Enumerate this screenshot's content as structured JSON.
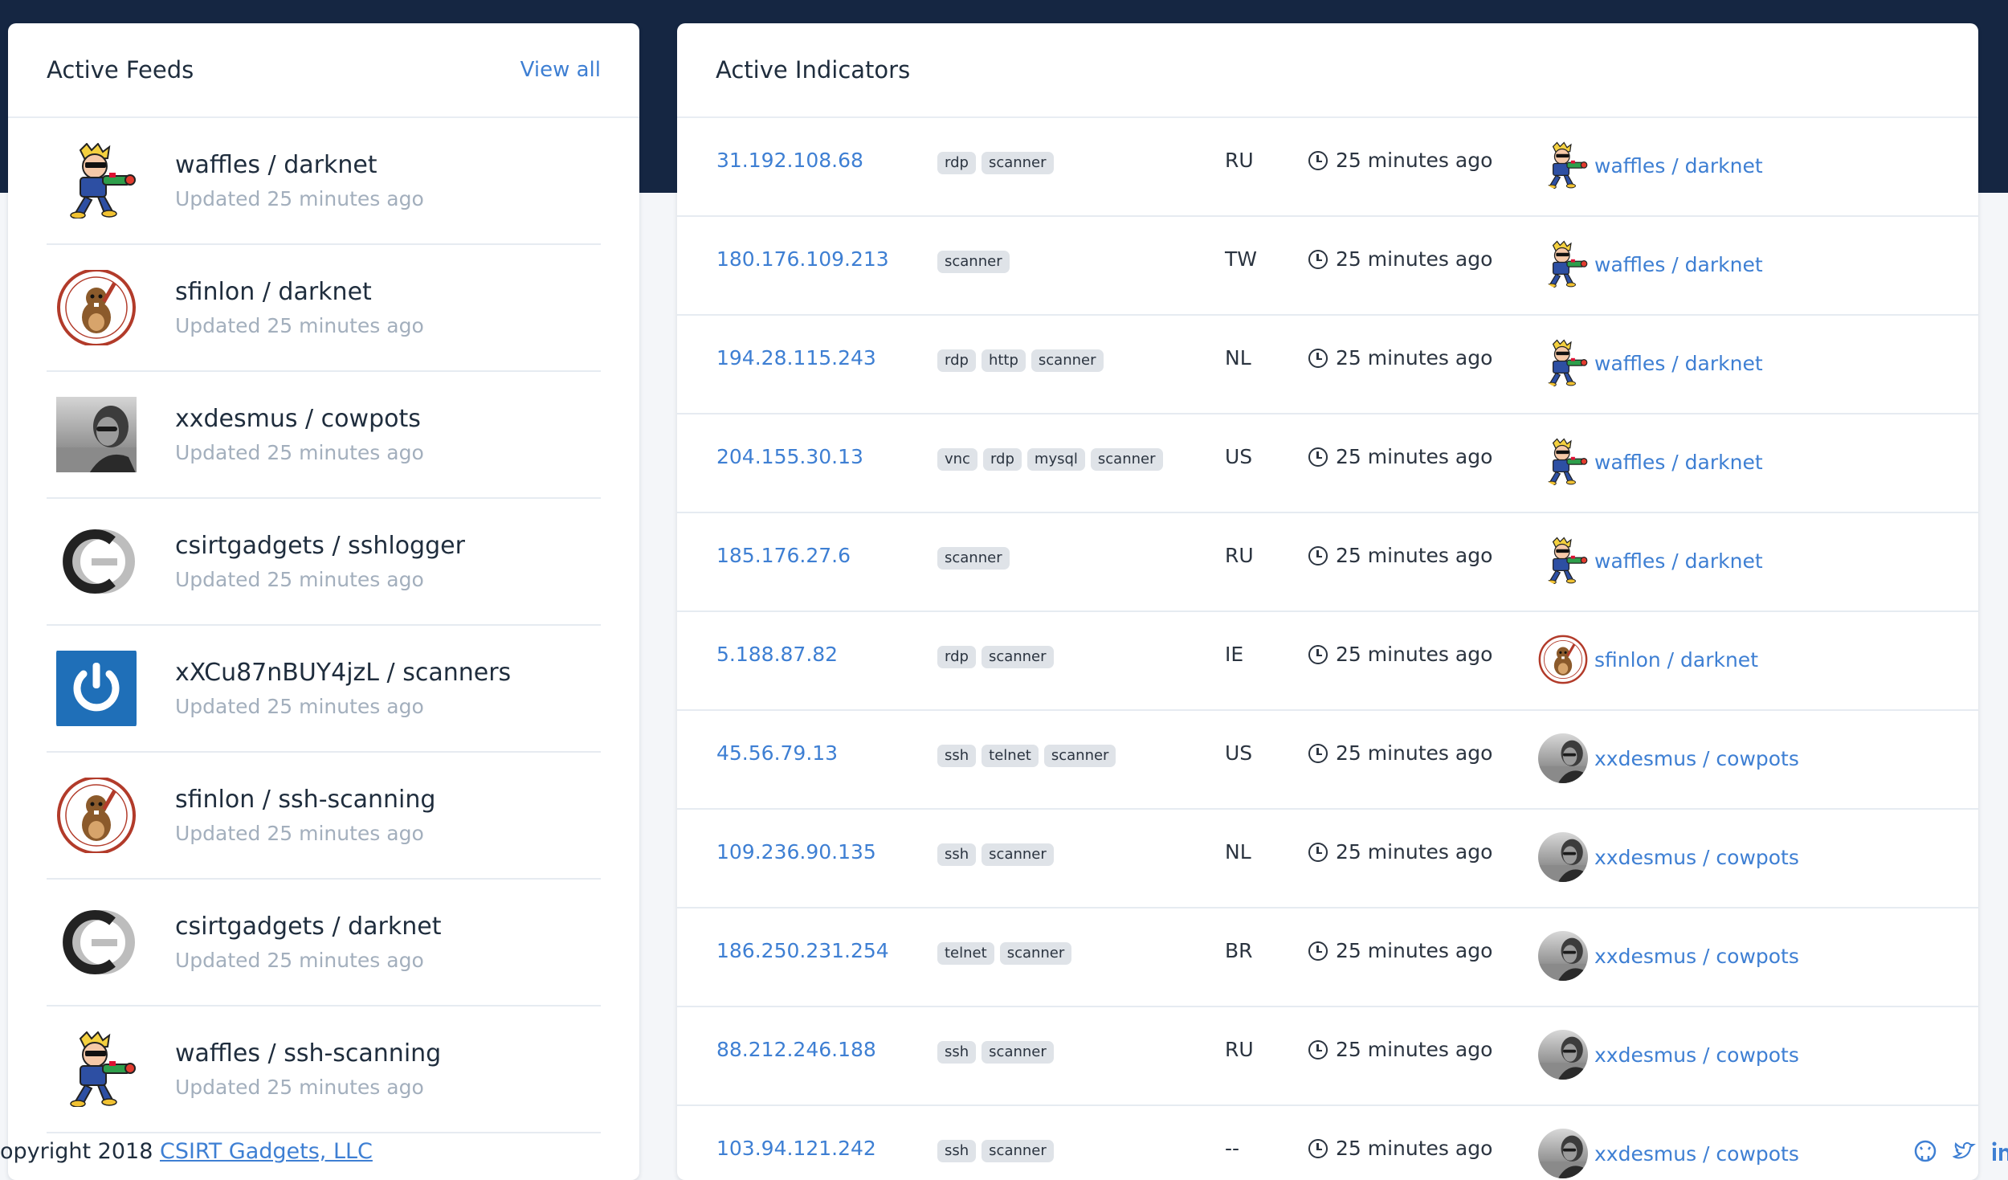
{
  "feeds": {
    "title": "Active Feeds",
    "view_all": "View all",
    "items": [
      {
        "name": "waffles / darknet",
        "updated": "Updated 25 minutes ago",
        "avatar": "cartoon-gunner"
      },
      {
        "name": "sfinlon / darknet",
        "updated": "Updated 25 minutes ago",
        "avatar": "beaver-badge"
      },
      {
        "name": "xxdesmus / cowpots",
        "updated": "Updated 25 minutes ago",
        "avatar": "photo-person"
      },
      {
        "name": "csirtgadgets / sshlogger",
        "updated": "Updated 25 minutes ago",
        "avatar": "cg-logo"
      },
      {
        "name": "xXCu87nBUY4jzL / scanners",
        "updated": "Updated 25 minutes ago",
        "avatar": "power-logo"
      },
      {
        "name": "sfinlon / ssh-scanning",
        "updated": "Updated 25 minutes ago",
        "avatar": "beaver-badge"
      },
      {
        "name": "csirtgadgets / darknet",
        "updated": "Updated 25 minutes ago",
        "avatar": "cg-logo"
      },
      {
        "name": "waffles / ssh-scanning",
        "updated": "Updated 25 minutes ago",
        "avatar": "cartoon-gunner"
      }
    ]
  },
  "indicators": {
    "title": "Active Indicators",
    "rows": [
      {
        "ip": "31.192.108.68",
        "tags": [
          "rdp",
          "scanner"
        ],
        "cc": "RU",
        "time": "25 minutes ago",
        "feed": "waffles / darknet",
        "avatar": "cartoon-gunner"
      },
      {
        "ip": "180.176.109.213",
        "tags": [
          "scanner"
        ],
        "cc": "TW",
        "time": "25 minutes ago",
        "feed": "waffles / darknet",
        "avatar": "cartoon-gunner"
      },
      {
        "ip": "194.28.115.243",
        "tags": [
          "rdp",
          "http",
          "scanner"
        ],
        "cc": "NL",
        "time": "25 minutes ago",
        "feed": "waffles / darknet",
        "avatar": "cartoon-gunner"
      },
      {
        "ip": "204.155.30.13",
        "tags": [
          "vnc",
          "rdp",
          "mysql",
          "scanner"
        ],
        "cc": "US",
        "time": "25 minutes ago",
        "feed": "waffles / darknet",
        "avatar": "cartoon-gunner"
      },
      {
        "ip": "185.176.27.6",
        "tags": [
          "scanner"
        ],
        "cc": "RU",
        "time": "25 minutes ago",
        "feed": "waffles / darknet",
        "avatar": "cartoon-gunner"
      },
      {
        "ip": "5.188.87.82",
        "tags": [
          "rdp",
          "scanner"
        ],
        "cc": "IE",
        "time": "25 minutes ago",
        "feed": "sfinlon / darknet",
        "avatar": "beaver-badge"
      },
      {
        "ip": "45.56.79.13",
        "tags": [
          "ssh",
          "telnet",
          "scanner"
        ],
        "cc": "US",
        "time": "25 minutes ago",
        "feed": "xxdesmus / cowpots",
        "avatar": "photo-person"
      },
      {
        "ip": "109.236.90.135",
        "tags": [
          "ssh",
          "scanner"
        ],
        "cc": "NL",
        "time": "25 minutes ago",
        "feed": "xxdesmus / cowpots",
        "avatar": "photo-person"
      },
      {
        "ip": "186.250.231.254",
        "tags": [
          "telnet",
          "scanner"
        ],
        "cc": "BR",
        "time": "25 minutes ago",
        "feed": "xxdesmus / cowpots",
        "avatar": "photo-person"
      },
      {
        "ip": "88.212.246.188",
        "tags": [
          "ssh",
          "scanner"
        ],
        "cc": "RU",
        "time": "25 minutes ago",
        "feed": "xxdesmus / cowpots",
        "avatar": "photo-person"
      },
      {
        "ip": "103.94.121.242",
        "tags": [
          "ssh",
          "scanner"
        ],
        "cc": "--",
        "time": "25 minutes ago",
        "feed": "xxdesmus / cowpots",
        "avatar": "photo-person"
      }
    ]
  },
  "footer": {
    "text": "opyright 2018 ",
    "link": "CSIRT Gadgets, LLC",
    "social": [
      "github-icon",
      "twitter-icon",
      "linkedin-icon"
    ]
  },
  "colors": {
    "navy": "#152642",
    "link": "#3e7fd3",
    "tag_bg": "#dfe3e8"
  }
}
